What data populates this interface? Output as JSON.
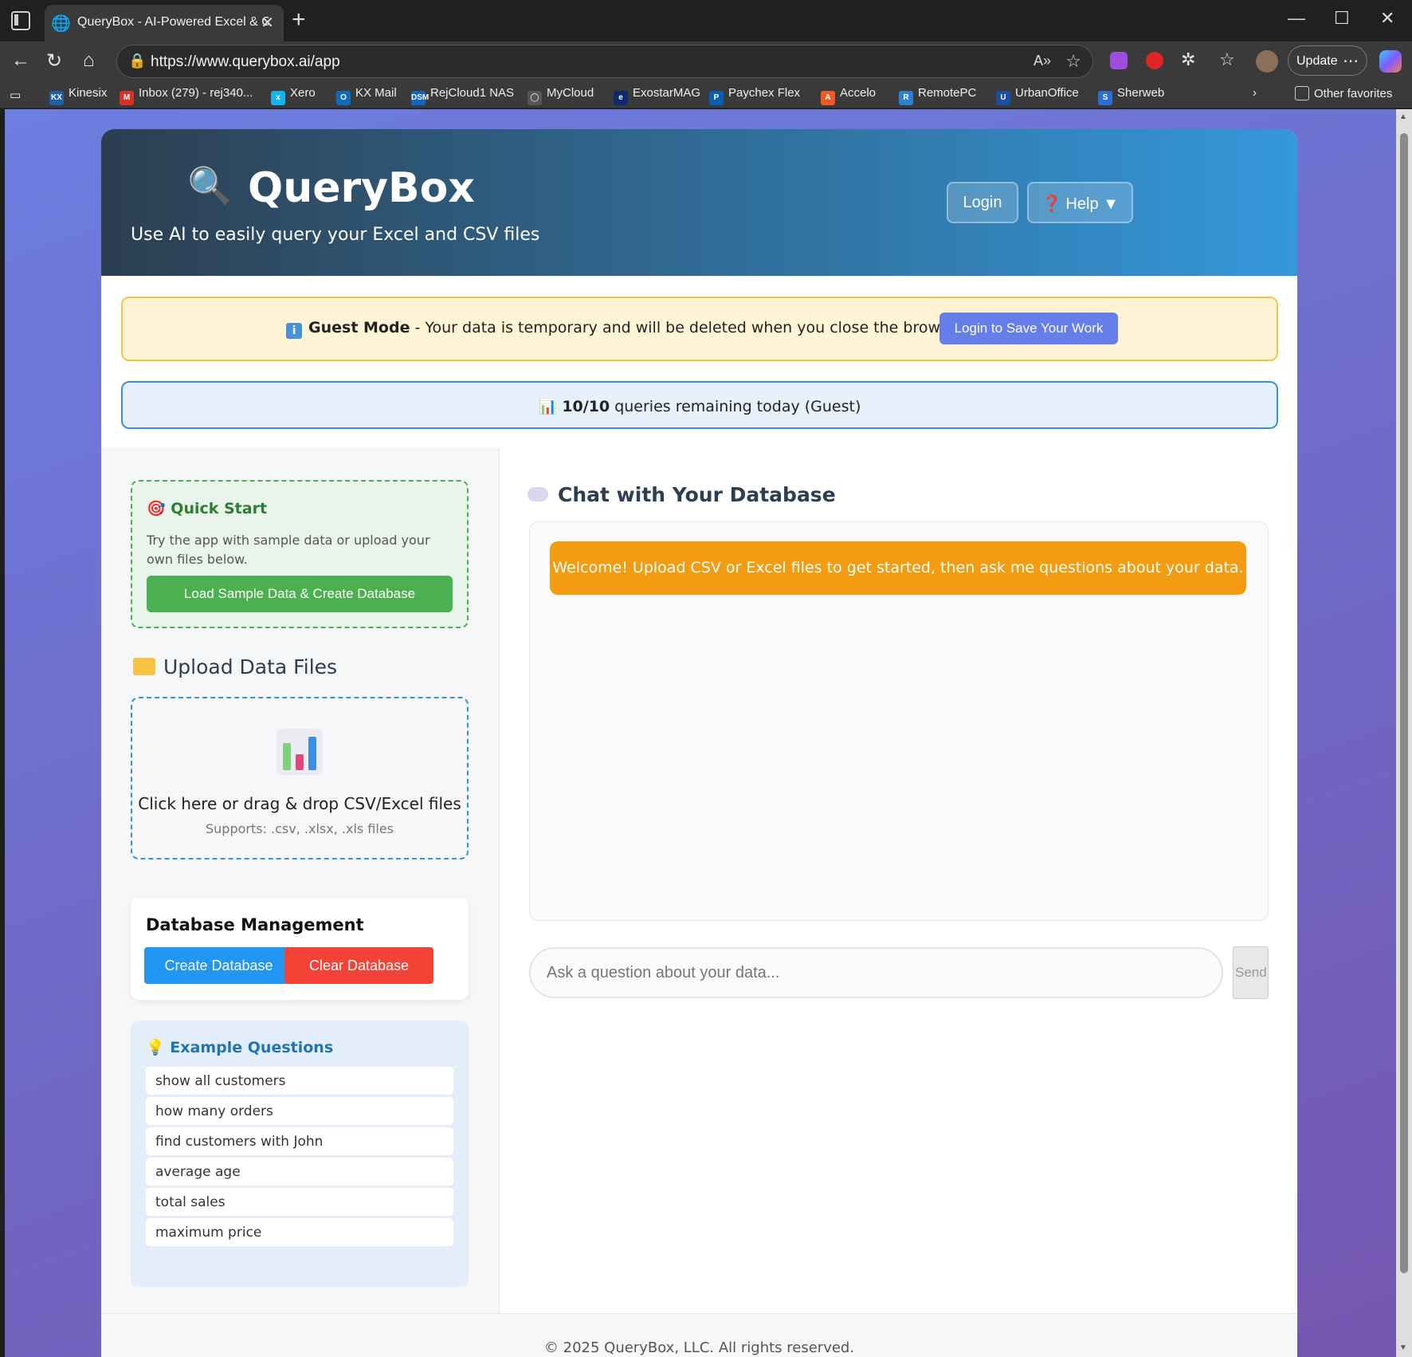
{
  "browser": {
    "tab_title": "QueryBox - AI-Powered Excel & C",
    "url": "https://www.querybox.ai/app",
    "update_label": "Update",
    "bookmarks": [
      {
        "label": "Kinesix",
        "icon": "KX",
        "color": "#1e5fa8"
      },
      {
        "label": "Inbox (279) - rej340...",
        "icon": "M",
        "color": "#d93025"
      },
      {
        "label": "Xero",
        "icon": "x",
        "color": "#13b5ea"
      },
      {
        "label": "KX Mail",
        "icon": "O",
        "color": "#0f6cbd"
      },
      {
        "label": "RejCloud1 NAS",
        "icon": "DSM",
        "color": "#1565c0"
      },
      {
        "label": "MyCloud",
        "icon": "◯",
        "color": "#555555"
      },
      {
        "label": "ExostarMAG",
        "icon": "e",
        "color": "#0d2a6e"
      },
      {
        "label": "Paychex Flex",
        "icon": "P",
        "color": "#0a5fb4"
      },
      {
        "label": "Accelo",
        "icon": "A",
        "color": "#f15a24"
      },
      {
        "label": "RemotePC",
        "icon": "R",
        "color": "#2d7fd3"
      },
      {
        "label": "UrbanOffice",
        "icon": "U",
        "color": "#1a4fa0"
      },
      {
        "label": "Sherweb",
        "icon": "S",
        "color": "#2b6fd6"
      }
    ],
    "other_favorites": "Other favorites"
  },
  "header": {
    "title": "QueryBox",
    "tagline": "Use AI to easily query your Excel and CSV files",
    "login_label": "Login",
    "help_label": "❓ Help ▼"
  },
  "guest_banner": {
    "bold": "Guest Mode",
    "text": " - Your data is temporary and will be deleted when you close the browser.",
    "button": "Login to Save Your Work"
  },
  "quota": {
    "count": "10/10",
    "text": " queries remaining today (Guest)"
  },
  "quick_start": {
    "title": "Quick Start",
    "text": "Try the app with sample data or upload your own files below.",
    "button": "Load Sample Data & Create Database"
  },
  "upload": {
    "title": "Upload Data Files",
    "drop_text": "Click here or drag & drop CSV/Excel files",
    "supports": "Supports: .csv, .xlsx, .xls files"
  },
  "db_management": {
    "title": "Database Management",
    "create": "Create Database",
    "clear": "Clear Database"
  },
  "examples": {
    "title": "Example Questions",
    "items": [
      "show all customers",
      "how many orders",
      "find customers with John",
      "average age",
      "total sales",
      "maximum price"
    ]
  },
  "chat": {
    "title": "Chat with Your Database",
    "welcome": "Welcome! Upload CSV or Excel files to get started, then ask me questions about your data.",
    "placeholder": "Ask a question about your data...",
    "send": "Send"
  },
  "footer": "© 2025 QueryBox, LLC. All rights reserved.",
  "colors": {
    "accent": "#667eea",
    "success": "#4caf50",
    "danger": "#f44336",
    "info": "#2196f3",
    "warning": "#f39c12"
  }
}
